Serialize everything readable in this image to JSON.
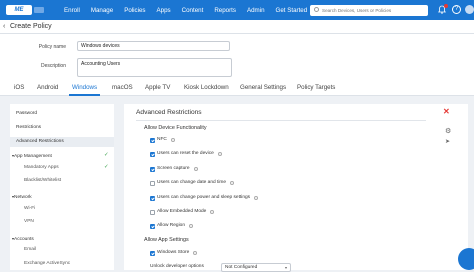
{
  "brand": {
    "logo_text": "ME",
    "accent": "#1b76d2"
  },
  "nav": [
    "Enroll",
    "Manage",
    "Policies",
    "Apps",
    "Content",
    "Reports",
    "Admin",
    "Get Started"
  ],
  "search": {
    "placeholder": "Search Devices, Users or Policies"
  },
  "icons": {
    "back": "chevron-left-icon",
    "bell": "bell-icon",
    "help": "help-icon",
    "close": "close-icon",
    "gear": "gear-icon"
  },
  "page": {
    "title": "Create Policy"
  },
  "form": {
    "name_label": "Policy name",
    "name_value": "Windows devices",
    "desc_label": "Description",
    "desc_value": "Accounting Users"
  },
  "tabs": [
    "iOS",
    "Android",
    "Windows",
    "macOS",
    "Apple TV",
    "Kiosk Lockdown",
    "General Settings",
    "Policy Targets"
  ],
  "active_tab": "Windows",
  "sidebar": {
    "items": [
      {
        "label": "Password"
      },
      {
        "label": "Restrictions"
      },
      {
        "label": "Advanced Restrictions"
      },
      {
        "label": "App Management"
      },
      {
        "label": "Mandatory Apps"
      },
      {
        "label": "Blacklist/Whitelist"
      },
      {
        "label": "Network"
      },
      {
        "label": "Wi-Fi"
      },
      {
        "label": "VPN"
      },
      {
        "label": "Accounts"
      },
      {
        "label": "Email"
      },
      {
        "label": "Exchange ActiveSync"
      }
    ],
    "check_glyph": "✓"
  },
  "panel": {
    "title": "Advanced Restrictions",
    "close_glyph": "✕",
    "section1": "Allow Device Functionality",
    "section2": "Allow App Settings",
    "options": [
      {
        "label": "NFC",
        "checked": true
      },
      {
        "label": "Users can reset the device",
        "checked": true
      },
      {
        "label": "Screen capture",
        "checked": true
      },
      {
        "label": "Users can change date and time",
        "checked": false
      },
      {
        "label": "Users can change power and sleep settings",
        "checked": true
      },
      {
        "label": "Allow Embedded Mode",
        "checked": false
      },
      {
        "label": "Allow Region",
        "checked": true
      },
      {
        "label": "Windows Store",
        "checked": true
      }
    ],
    "unlock_label": "Unlock developer options",
    "unlock_value": "Not Configured"
  }
}
